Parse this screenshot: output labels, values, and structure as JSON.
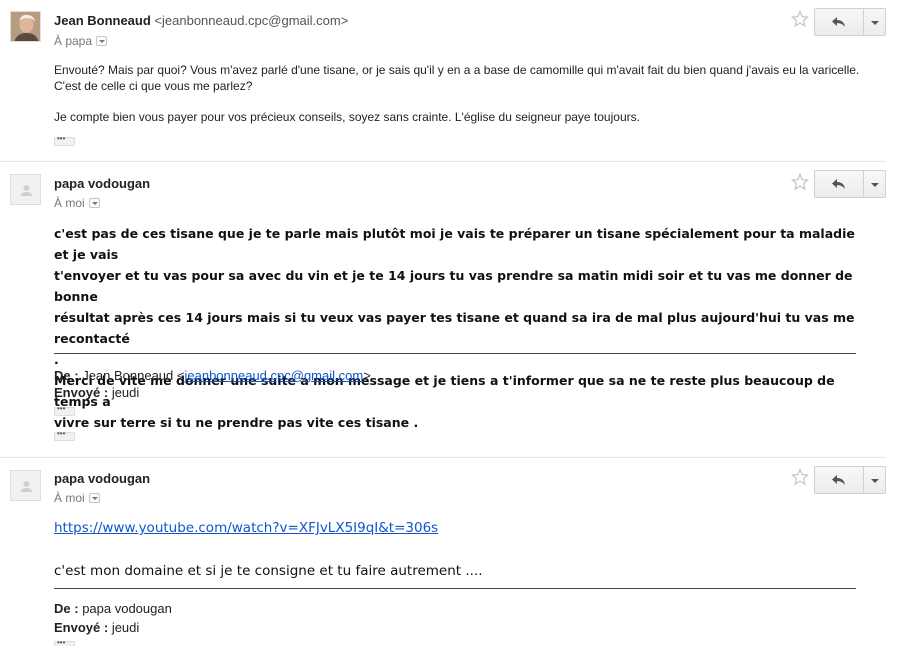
{
  "messages": [
    {
      "sender_name": "Jean Bonneaud",
      "sender_email": "<jeanbonneaud.cpc@gmail.com>",
      "to": "À papa",
      "body": [
        "Envouté? Mais par quoi? Vous m'avez parlé d'une tisane, or je sais qu'il y en a a base de camomille qui m'avait fait du bien quand j'avais eu la varicelle. C'est de celle ci que vous me parlez?",
        "Je compte bien vous payer pour vos précieux conseils, soyez sans crainte. L'église du seigneur paye toujours."
      ]
    },
    {
      "sender_name": "papa vodougan",
      "to": "À moi",
      "body_bold": [
        "c'est pas de ces tisane que je te parle mais plutôt  moi je vais te préparer un tisane spécialement pour ta maladie et je vais",
        "t'envoyer et tu vas pour sa avec du vin et je te  14 jours tu vas prendre sa matin midi soir et tu vas me donner de bonne",
        "résultat après ces 14 jours mais si tu veux vas payer tes tisane et quand sa ira de mal plus aujourd'hui tu vas me recontacté",
        ".",
        "Merci de vite me donner une suite a mon message et je tiens a t'informer que sa ne te reste plus beaucoup de temps a",
        "vivre sur terre si tu ne prendre pas vite ces tisane ."
      ],
      "quote": {
        "from_label": "De :",
        "from_name": "Jean Bonneaud <",
        "from_email": "jeanbonneaud.cpc@gmail.com",
        "from_close": ">",
        "sent_label": "Envoyé :",
        "sent_value": "jeudi"
      }
    },
    {
      "sender_name": "papa vodougan",
      "to": "À moi",
      "link": "https://www.youtube.com/watch?v=XFJvLX5I9qI&t=306s",
      "body_line": "c'est mon domaine et si je te consigne et tu faire autrement ....",
      "quote": {
        "from_label": "De :",
        "from_name": "papa vodougan",
        "sent_label": "Envoyé :",
        "sent_value": "jeudi"
      }
    }
  ],
  "icons": {
    "star": "star-icon",
    "reply": "reply-icon",
    "more": "dropdown-arrow-icon",
    "avatar_default": "default-avatar-icon"
  },
  "colors": {
    "link": "#1155cc",
    "divider": "#e5e5e5",
    "star": "#c6c6c6"
  }
}
